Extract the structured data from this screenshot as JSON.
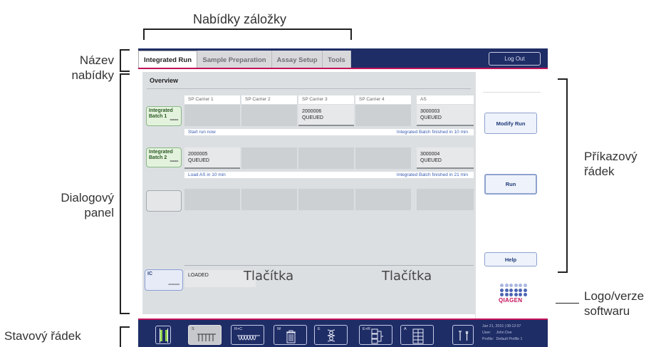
{
  "annotations": {
    "tab_menus": "Nabídky záložky",
    "menu_name_l1": "Název",
    "menu_name_l2": "nabídky",
    "dialog_panel_l1": "Dialogový",
    "dialog_panel_l2": "panel",
    "command_bar_l1": "Příkazový",
    "command_bar_l2": "řádek",
    "logo_version_l1": "Logo/verze",
    "logo_version_l2": "softwaru",
    "status_bar": "Stavový řádek",
    "buttons_1": "Tlačítka",
    "buttons_2": "Tlačítka"
  },
  "tabs": [
    "Integrated Run",
    "Sample Preparation",
    "Assay Setup",
    "Tools"
  ],
  "logout_label": "Log Out",
  "dialog": {
    "title": "Overview",
    "columns": [
      "SP Carrier 1",
      "SP Carrier 2",
      "SP Carrier 3",
      "SP Carrier 4",
      "AS"
    ],
    "batches": [
      {
        "name_l1": "Integrated",
        "name_l2": "Batch 1",
        "stars": "********",
        "cells": [
          {
            "code": "",
            "status": ""
          },
          {
            "code": "",
            "status": ""
          },
          {
            "code": "2000006",
            "status": "QUEUED"
          },
          {
            "code": "",
            "status": ""
          },
          {
            "code": "3000003",
            "status": "QUEUED"
          }
        ],
        "info_left": "Start run now",
        "info_right": "Integrated Batch finished in 10 min"
      },
      {
        "name_l1": "Integrated",
        "name_l2": "Batch 2",
        "stars": "********",
        "cells": [
          {
            "code": "2000005",
            "status": "QUEUED"
          },
          {
            "code": "",
            "status": ""
          },
          {
            "code": "",
            "status": ""
          },
          {
            "code": "",
            "status": ""
          },
          {
            "code": "3000004",
            "status": "QUEUED"
          }
        ],
        "info_left": "Load AS in 10 min",
        "info_right": "Integrated Batch finished in 21 min"
      }
    ],
    "ic_label": "IC",
    "ic_stars": "********",
    "loaded_label": "LOADED"
  },
  "command_buttons": {
    "modify_run": "Modify Run",
    "run": "Run",
    "help": "Help"
  },
  "logo_text": "QIAGEN",
  "status_buttons": {
    "s": "S",
    "rc": "R+C",
    "w": "W",
    "e": "E",
    "er": "E+R",
    "a": "A"
  },
  "status_info": {
    "datetime": "Jan 21, 2015 | 08:12:07",
    "user_key": "User:",
    "user_val": "John Doe",
    "profile_key": "Profile:",
    "profile_val": "Default Profile 1"
  },
  "colors": {
    "navy": "#1f2d66",
    "accent": "#c2135a",
    "batch_green": "#e3f2dd",
    "ic_blue": "#e6ebf7"
  }
}
